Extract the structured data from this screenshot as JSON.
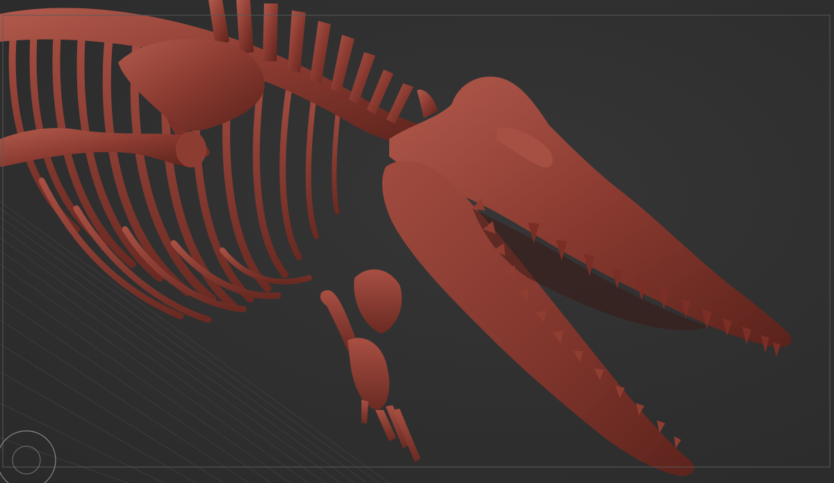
{
  "app": {
    "viewport_label": "",
    "model": "whale-skeleton-sculpt"
  },
  "colors": {
    "background": "#2f2f2f",
    "bone_base": "#8a3a30",
    "bone_light": "#b0564a",
    "bone_dark": "#4a1a15",
    "frame_line": "#5a5a5a",
    "floor_grid": "#4a4a4a"
  },
  "icons": {
    "gizmo": "circle-target-icon"
  }
}
